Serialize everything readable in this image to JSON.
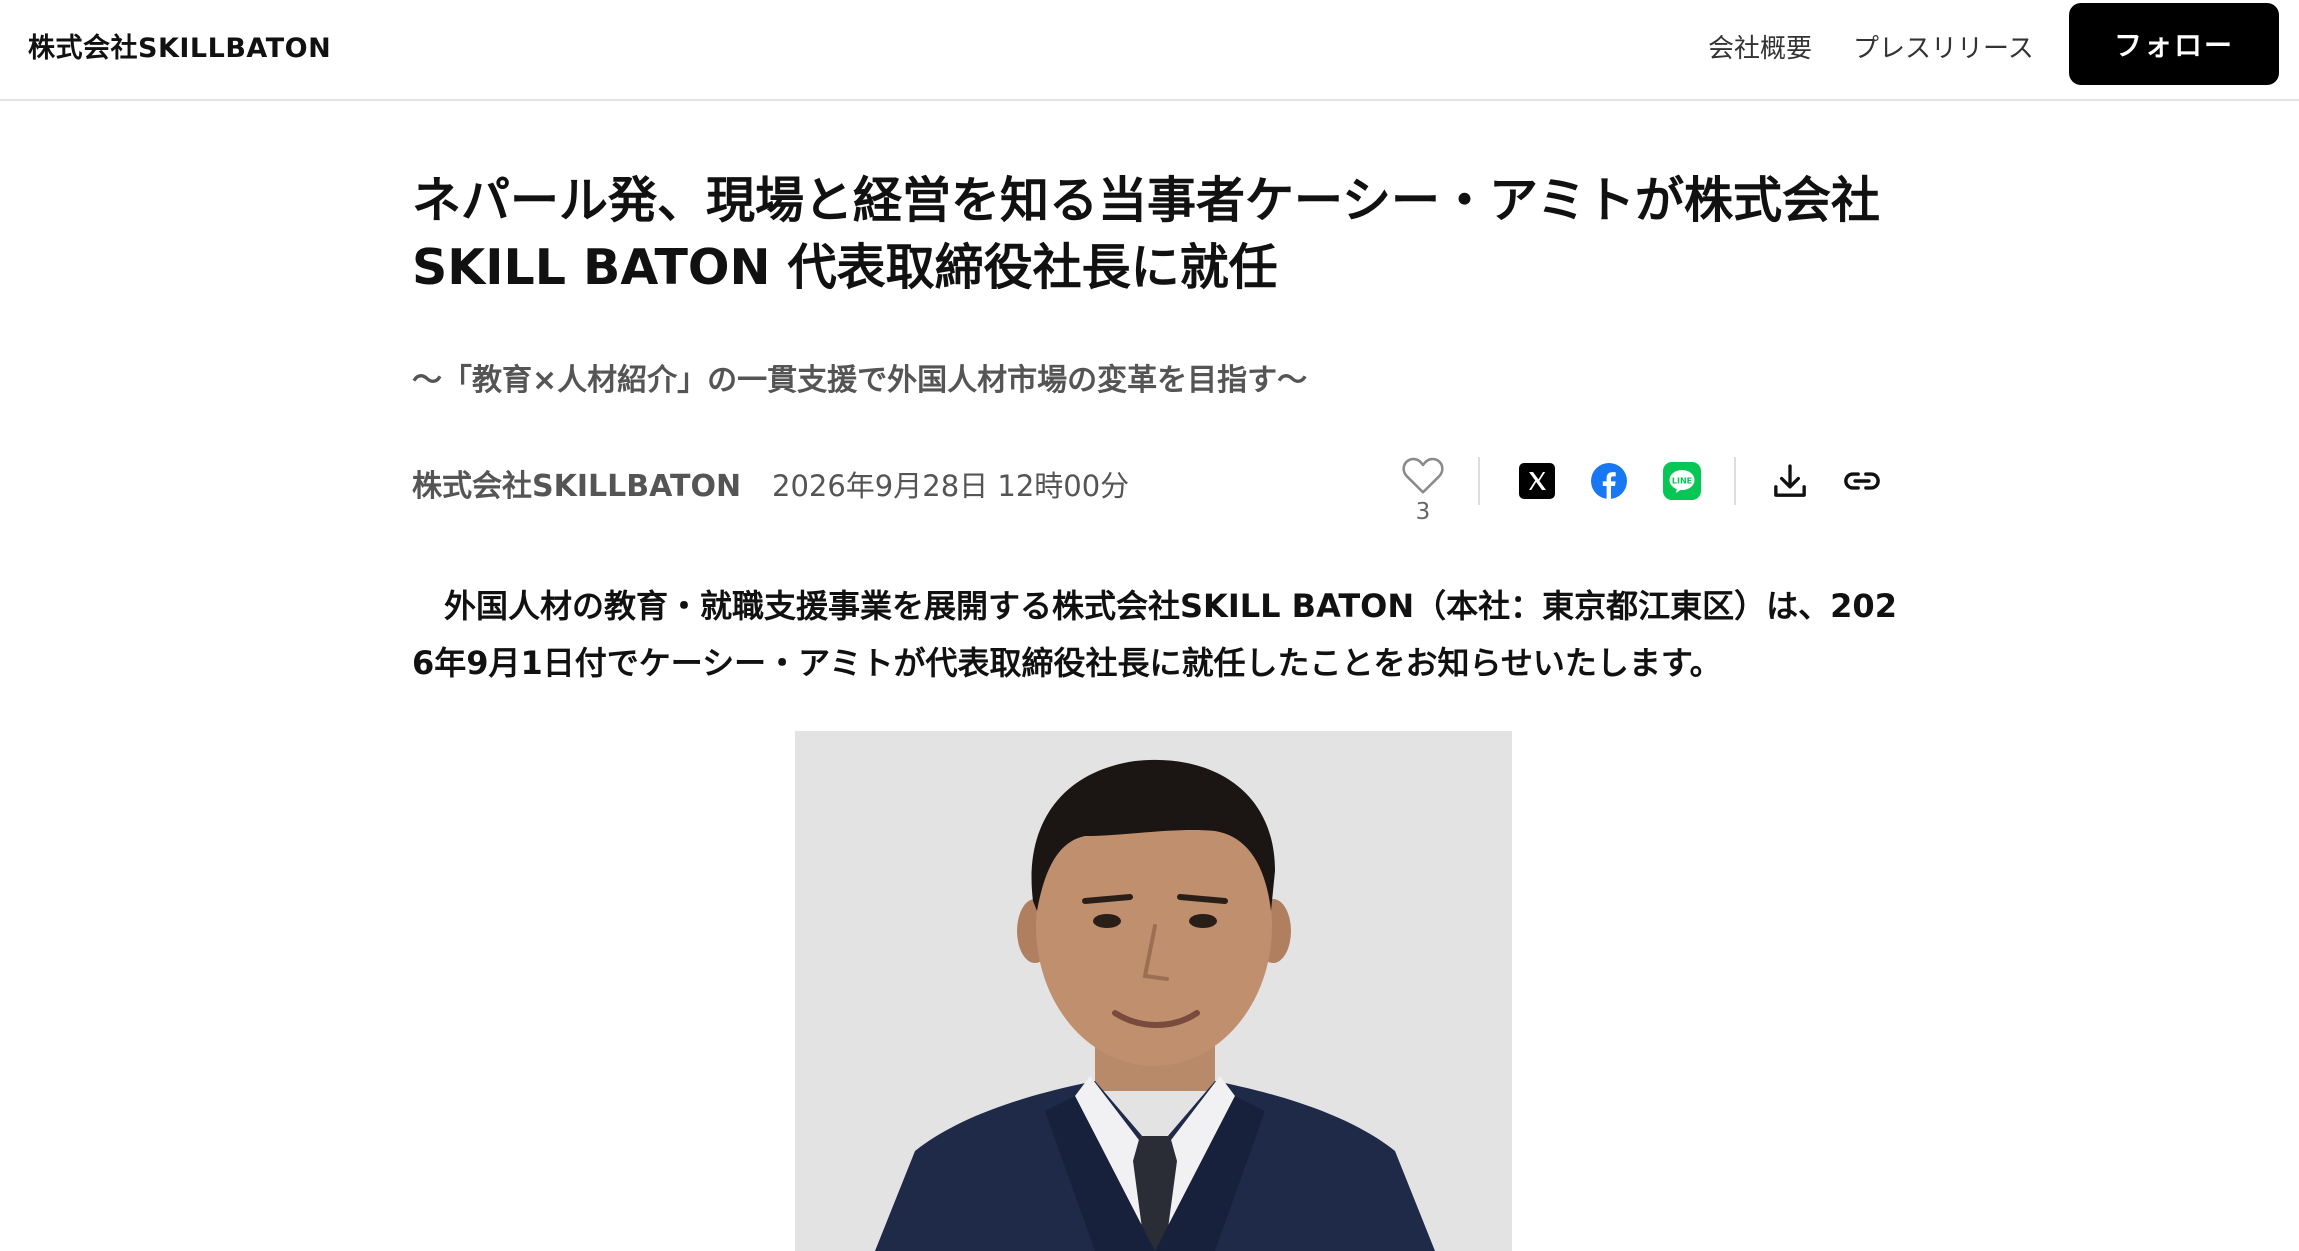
{
  "header": {
    "brand": "株式会社SKILLBATON",
    "nav": {
      "about": "会社概要",
      "press": "プレスリリース"
    },
    "follow_label": "フォロー"
  },
  "article": {
    "title": "ネパール発、現場と経営を知る当事者ケーシー・アミトが株式会社SKILL BATON 代表取締役社長に就任",
    "subtitle": "〜「教育×人材紹介」の一貫支援で外国人材市場の変革を目指す〜",
    "company": "株式会社SKILLBATON",
    "date": "2026年9月28日 12時00分",
    "like_count": "3",
    "lead": "外国人材の教育・就職支援事業を展開する株式会社SKILL BATON（本社：東京都江東区）は、2026年9月1日付でケーシー・アミトが代表取締役社長に就任したことをお知らせいたします。"
  },
  "icons": {
    "like": "heart-icon",
    "x": "x-logo-icon",
    "facebook": "facebook-icon",
    "line": "line-icon",
    "download": "download-icon",
    "link": "link-icon"
  },
  "colors": {
    "facebook": "#1877f2",
    "line": "#06c755",
    "follow_bg": "#000000"
  }
}
